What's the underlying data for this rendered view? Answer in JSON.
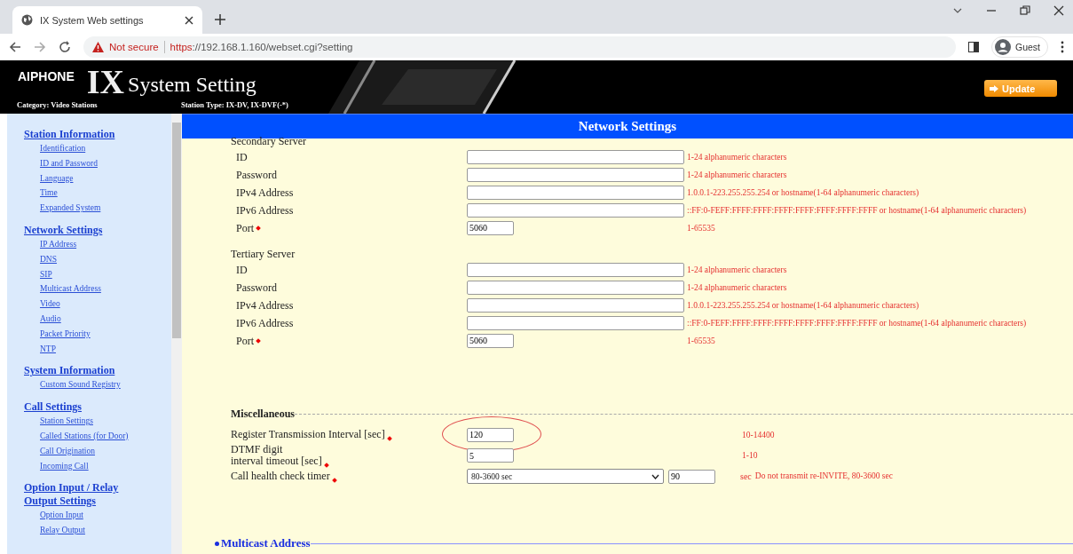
{
  "browser": {
    "tab_title": "IX System Web settings",
    "security": "Not secure",
    "url_scheme": "https",
    "url_rest": "://192.168.1.160/webset.cgi?setting",
    "profile": "Guest"
  },
  "header": {
    "brand": "AIPHONE",
    "title_big": "IX",
    "title": "System Setting",
    "category": "Category:  Video Stations",
    "station_type": "Station Type:  IX-DV, IX-DVF(-*)",
    "update_button": "Update"
  },
  "sidebar": {
    "sections": [
      {
        "title": "Station Information",
        "items": [
          "Identification",
          "ID and Password",
          "Language",
          "Time",
          "Expanded System"
        ]
      },
      {
        "title": "Network Settings",
        "items": [
          "IP Address",
          "DNS",
          "SIP",
          "Multicast Address",
          "Video",
          "Audio",
          "Packet Priority",
          "NTP"
        ]
      },
      {
        "title": "System Information",
        "items": [
          "Custom Sound Registry"
        ]
      },
      {
        "title": "Call Settings",
        "items": [
          "Station Settings",
          "Called Stations (for Door)",
          "Call Origination",
          "Incoming Call"
        ]
      },
      {
        "title": "Option Input / Relay Output Settings",
        "items": [
          "Option Input",
          "Relay Output"
        ]
      }
    ]
  },
  "panel": {
    "title": "Network Settings",
    "server_groups": [
      {
        "title": "Secondary Server",
        "rows": [
          {
            "label": "ID",
            "required": false,
            "value": "",
            "hint": "1-24 alphanumeric characters"
          },
          {
            "label": "Password",
            "required": false,
            "value": "",
            "hint": "1-24 alphanumeric characters"
          },
          {
            "label": "IPv4 Address",
            "required": false,
            "value": "",
            "hint": "1.0.0.1-223.255.255.254 or hostname(1-64 alphanumeric characters)"
          },
          {
            "label": "IPv6 Address",
            "required": false,
            "value": "",
            "hint": "::FF:0-FEFF:FFFF:FFFF:FFFF:FFFF:FFFF:FFFF:FFFF or hostname(1-64 alphanumeric characters)"
          },
          {
            "label": "Port",
            "required": true,
            "value": "5060",
            "hint": "1-65535"
          }
        ]
      },
      {
        "title": "Tertiary Server",
        "rows": [
          {
            "label": "ID",
            "required": false,
            "value": "",
            "hint": "1-24 alphanumeric characters"
          },
          {
            "label": "Password",
            "required": false,
            "value": "",
            "hint": "1-24 alphanumeric characters"
          },
          {
            "label": "IPv4 Address",
            "required": false,
            "value": "",
            "hint": "1.0.0.1-223.255.255.254 or hostname(1-64 alphanumeric characters)"
          },
          {
            "label": "IPv6 Address",
            "required": false,
            "value": "",
            "hint": "::FF:0-FEFF:FFFF:FFFF:FFFF:FFFF:FFFF:FFFF:FFFF or hostname(1-64 alphanumeric characters)"
          },
          {
            "label": "Port",
            "required": true,
            "value": "5060",
            "hint": "1-65535"
          }
        ]
      }
    ],
    "misc": {
      "title": "Miscellaneous",
      "rows": [
        {
          "kind": "input",
          "label": "Register Transmission Interval [sec]",
          "required": true,
          "value": "120",
          "hint": "10-14400",
          "highlighted": true
        },
        {
          "kind": "input",
          "label": "DTMF digit\ninterval timeout [sec]",
          "required": true,
          "value": "5",
          "hint": "1-10",
          "highlighted": false
        },
        {
          "kind": "select",
          "label": "Call health check timer",
          "required": true,
          "value": "80-3600 sec",
          "extra_value": "90",
          "unit": "sec",
          "hint": "Do not transmit re-INVITE, 80-3600 sec",
          "highlighted": false
        }
      ]
    },
    "next_section": "Multicast Address"
  }
}
